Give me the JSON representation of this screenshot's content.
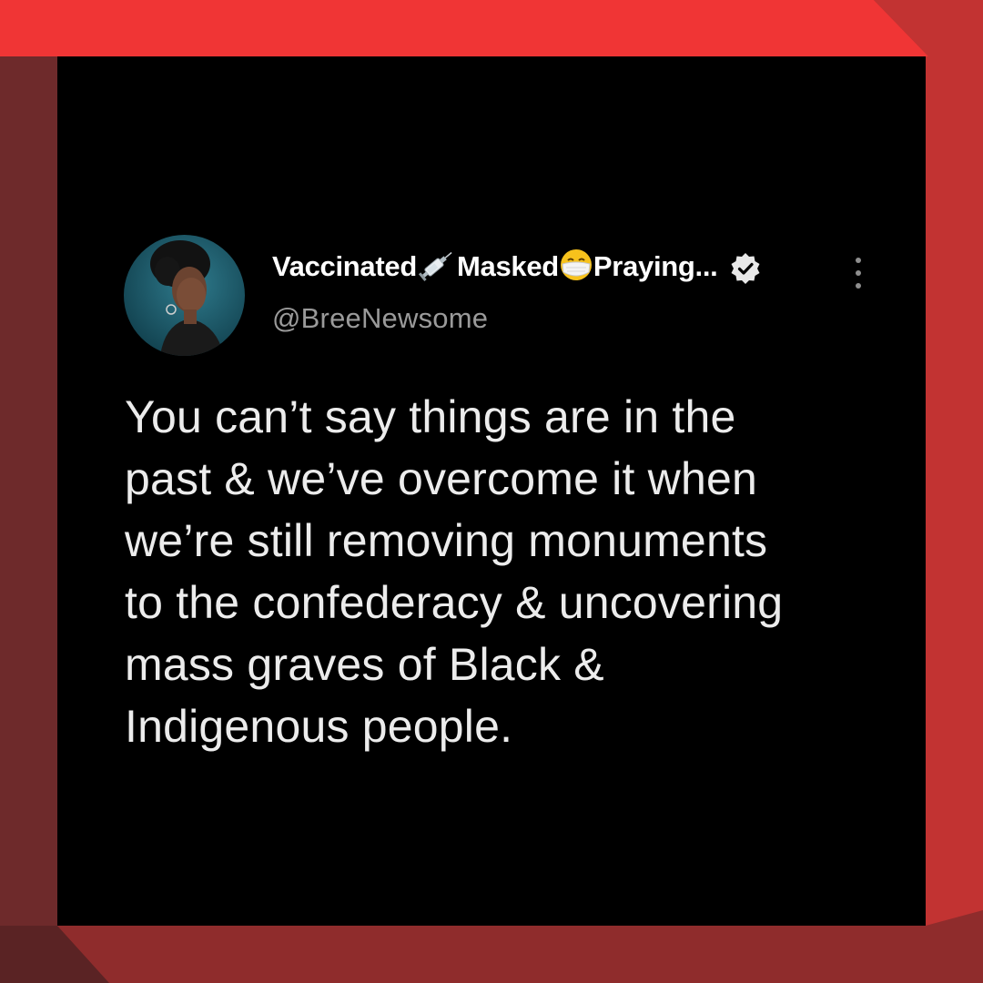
{
  "tweet": {
    "name_parts": {
      "vaccinated": "Vaccinated",
      "masked": "Masked",
      "praying": "Praying..."
    },
    "icons": [
      "syringe-emoji",
      "face-with-medical-mask-emoji",
      "verified-badge-icon",
      "more-options-icon"
    ],
    "handle": "@BreeNewsome",
    "text": "You can’t say things are in the\npast & we’ve overcome it when\nwe’re still removing monuments\nto the confederacy & uncovering\nmass graves of Black &\nIndigenous people."
  },
  "colors": {
    "frame_bright": "#f03535",
    "frame_mid": "#c23332",
    "frame_dark": "#6e2a2b",
    "card_bg": "#000000",
    "text": "#ececec",
    "handle": "#9a9a9a"
  }
}
